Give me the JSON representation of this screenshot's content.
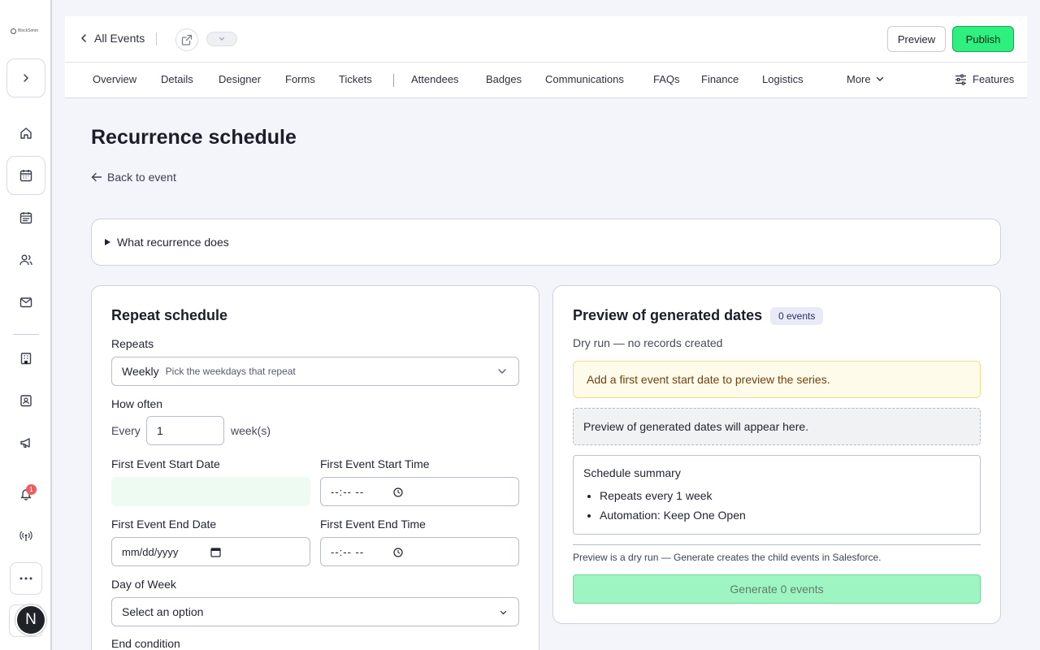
{
  "rail": {
    "logo_text": "BlockSimm",
    "notification_count": "1",
    "avatar_letter": "N"
  },
  "header": {
    "back_label": "All Events",
    "preview_label": "Preview",
    "publish_label": "Publish"
  },
  "tabs": [
    "Overview",
    "Details",
    "Designer",
    "Forms",
    "Tickets",
    "Attendees",
    "Badges",
    "Communications",
    "FAQs",
    "Finance",
    "Logistics"
  ],
  "tab_more": "More",
  "features_label": "Features",
  "page": {
    "title": "Recurrence schedule",
    "back_to_event": "Back to event",
    "details_summary": "What recurrence does"
  },
  "schedule": {
    "title": "Repeat schedule",
    "repeats_label": "Repeats",
    "repeats_value": "Weekly",
    "repeats_hint": "Pick the weekdays that repeat",
    "how_often_label": "How often",
    "every_label": "Every",
    "interval_value": "1",
    "unit_label": "week(s)",
    "start_date_label": "First Event Start Date",
    "start_time_label": "First Event Start Time",
    "end_date_label": "First Event End Date",
    "end_time_label": "First Event End Time",
    "time_placeholder": "--:-- --",
    "date_placeholder": "mm/dd/yyyy",
    "day_of_week_label": "Day of Week",
    "day_of_week_value": "Select an option",
    "end_condition_label": "End condition"
  },
  "preview": {
    "title": "Preview of generated dates",
    "badge": "0 events",
    "subtitle": "Dry run — no records created",
    "warning": "Add a first event start date to preview the series.",
    "empty": "Preview of generated dates will appear here.",
    "summary_title": "Schedule summary",
    "summary_items": [
      "Repeats every 1 week",
      "Automation: Keep One Open"
    ],
    "note": "Preview is a dry run — Generate creates the child events in Salesforce.",
    "generate_label": "Generate 0 events"
  },
  "colors": {
    "publish_bg": "#2ef07f",
    "generate_bg": "#9ef5c2",
    "warning_bg": "#fffbea",
    "badge_bg": "#e8eaf8",
    "notification": "#f05d5d"
  }
}
